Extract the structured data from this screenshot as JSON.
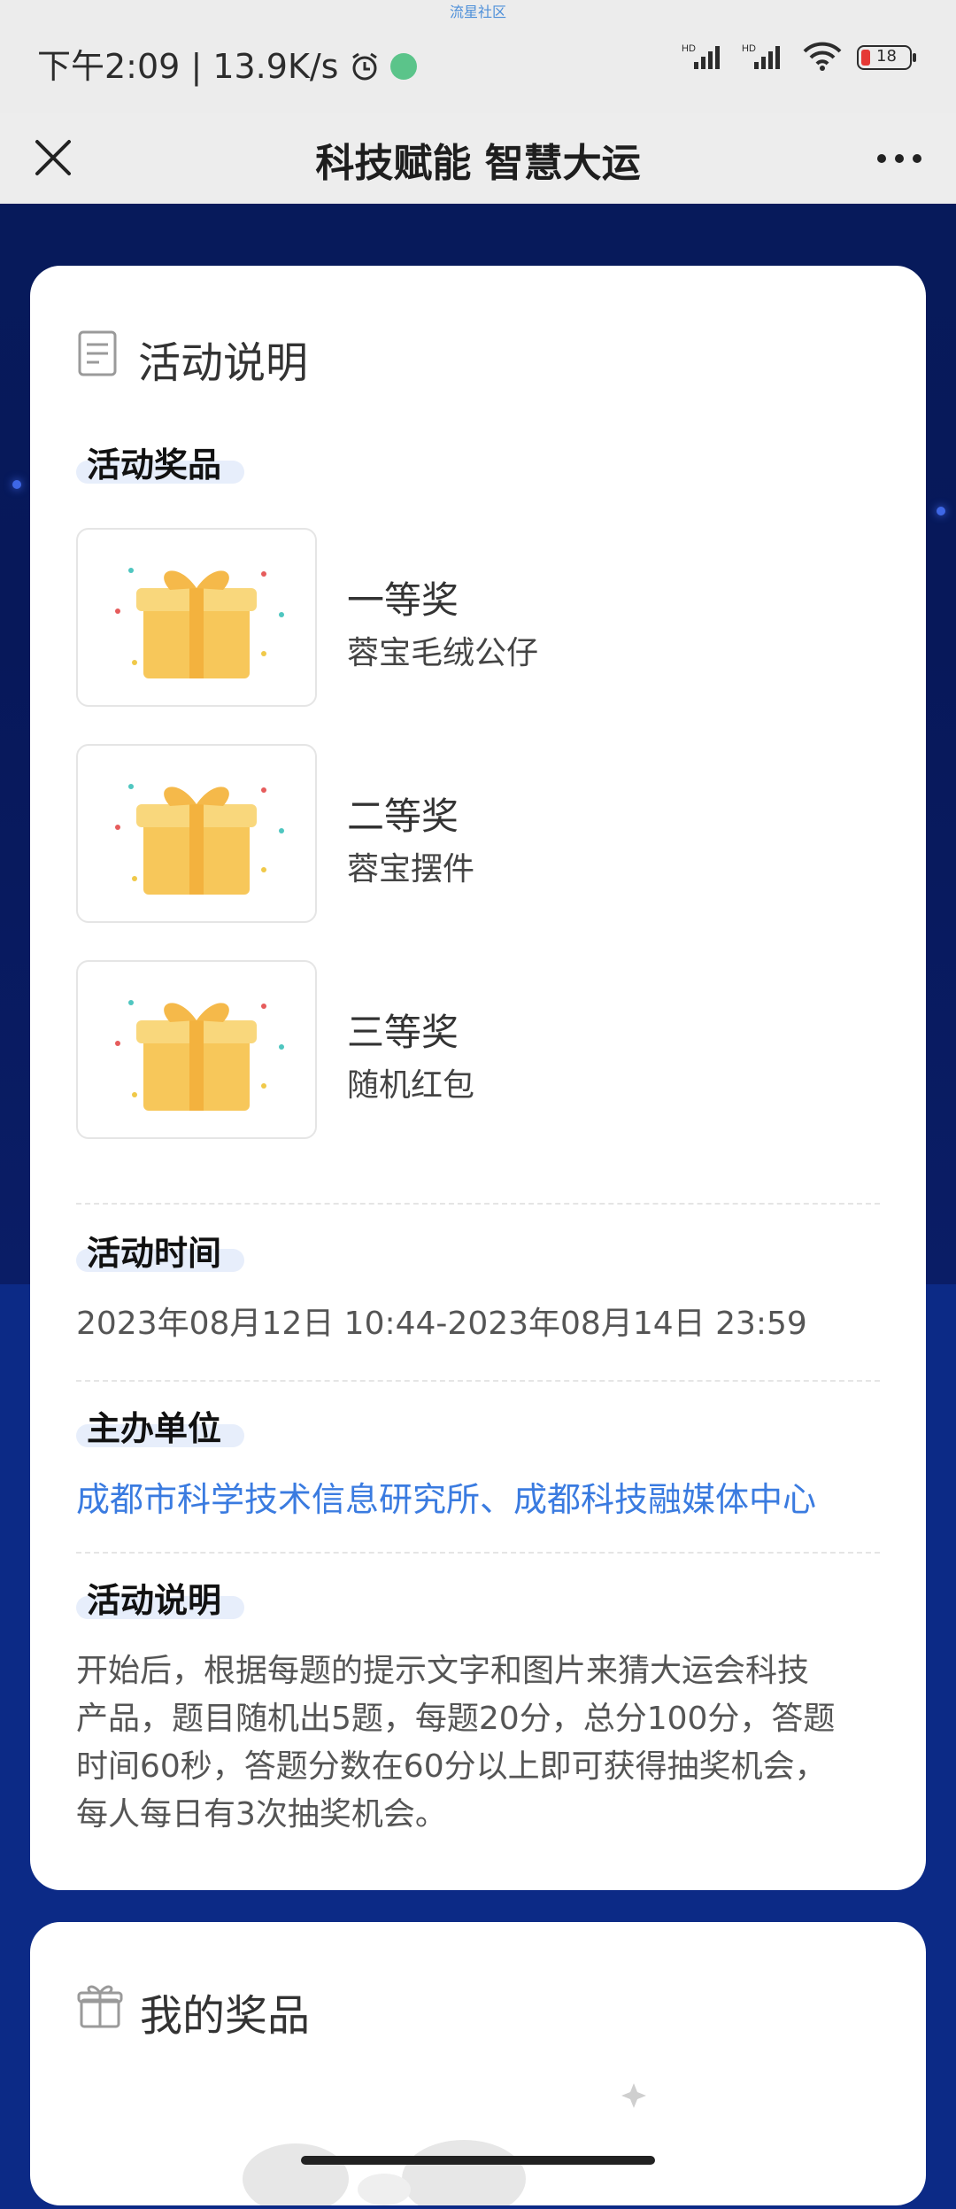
{
  "status_bar": {
    "top_note": "流星社区",
    "time": "下午2:09",
    "speed": "13.9K/s",
    "battery": "18"
  },
  "title_bar": {
    "title": "科技赋能 智慧大运"
  },
  "activity": {
    "section_title": "活动说明",
    "prizes_header": "活动奖品",
    "prizes": [
      {
        "name": "一等奖",
        "desc": "蓉宝毛绒公仔"
      },
      {
        "name": "二等奖",
        "desc": "蓉宝摆件"
      },
      {
        "name": "三等奖",
        "desc": "随机红包"
      }
    ],
    "time_header": "活动时间",
    "time_value": "2023年08月12日 10:44-2023年08月14日 23:59",
    "organizer_header": "主办单位",
    "organizer_value": "成都市科学技术信息研究所、成都科技融媒体中心",
    "desc_header": "活动说明",
    "desc_lines": [
      "开始后，根据每题的提示文字和图片来猜大运会科技",
      "产品，题目随机出5题，每题20分，总分100分，答题",
      "时间60秒，答题分数在60分以上即可获得抽奖机会，",
      "每人每日有3次抽奖机会。"
    ]
  },
  "my_prizes": {
    "section_title": "我的奖品"
  }
}
